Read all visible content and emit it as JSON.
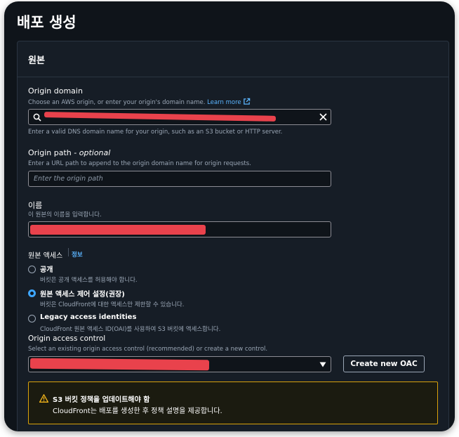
{
  "page": {
    "title": "배포 생성"
  },
  "origin": {
    "section_title": "원본",
    "domain": {
      "label": "Origin domain",
      "description": "Choose an AWS origin, or enter your origin's domain name.",
      "learn_more": "Learn more",
      "hint": "Enter a valid DNS domain name for your origin, such as an S3 bucket or HTTP server."
    },
    "path": {
      "label": "Origin path",
      "optional": "- optional",
      "description": "Enter a URL path to append to the origin domain name for origin requests.",
      "placeholder": "Enter the origin path"
    },
    "name": {
      "label": "이름",
      "description": "이 원본의 이름을 입력합니다."
    },
    "access": {
      "label": "원본 액세스",
      "info": "정보",
      "options": [
        {
          "label": "공개",
          "description": "버킷은 공개 액세스를 허용해야 합니다.",
          "selected": false
        },
        {
          "label": "원본 액세스 제어 설정(권장)",
          "description": "버킷은 CloudFront에 대한 액세스만 제한할 수 있습니다.",
          "selected": true
        },
        {
          "label": "Legacy access identities",
          "description": "CloudFront 원본 액세스 ID(OAI)를 사용하여 S3 버킷에 액세스합니다.",
          "selected": false
        }
      ]
    },
    "oac": {
      "label": "Origin access control",
      "description": "Select an existing origin access control (recommended) or create a new control.",
      "create_button": "Create new OAC"
    },
    "alert": {
      "title": "S3 버킷 정책을 업데이트해야 함",
      "message": "CloudFront는 배포를 생성한 후 정책 설명을 제공합니다."
    }
  }
}
